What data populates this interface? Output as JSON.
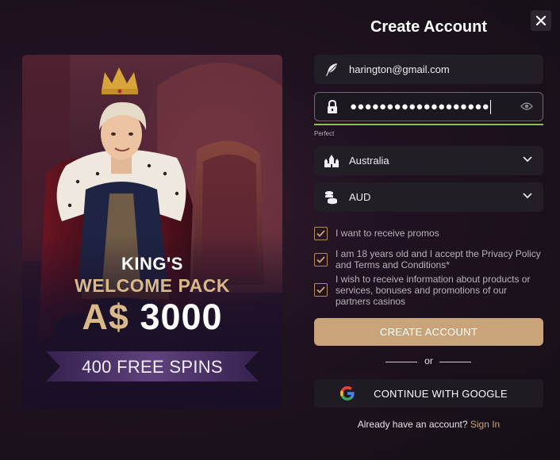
{
  "dialog": {
    "title": "Create Account",
    "close_label": "×"
  },
  "promo": {
    "line1": "KING'S",
    "line2": "WELCOME PACK",
    "currency": "A$",
    "amount": "3000",
    "spins": "400 FREE SPINS"
  },
  "form": {
    "email": {
      "value": "harington@gmail.com",
      "icon": "feather-icon"
    },
    "password": {
      "masked": "●●●●●●●●●●●●●●●●●●●",
      "icon": "lock-icon",
      "toggle_icon": "eye-icon"
    },
    "password_strength": {
      "label": "Perfect",
      "color": "#8bc34a"
    },
    "country": {
      "value": "Australia",
      "icon": "castle-icon"
    },
    "currency": {
      "value": "AUD",
      "icon": "coins-icon"
    },
    "checkboxes": [
      {
        "label": "I want to receive promos",
        "checked": true
      },
      {
        "label": "I am 18 years old and I accept the Privacy Policy and Terms and Conditions*",
        "checked": true
      },
      {
        "label": "I wish to receive information about products or services, bonuses and promotions of our partners casinos",
        "checked": true
      }
    ],
    "submit_label": "CREATE ACCOUNT",
    "or_text": "or",
    "google_label": "CONTINUE WITH GOOGLE",
    "signin_prompt": "Already have an account?",
    "signin_link": "Sign In"
  },
  "colors": {
    "accent": "#c9a47a",
    "gold_text": "#d9b98a",
    "field_bg": "#231d26",
    "background": "#1a1219"
  }
}
